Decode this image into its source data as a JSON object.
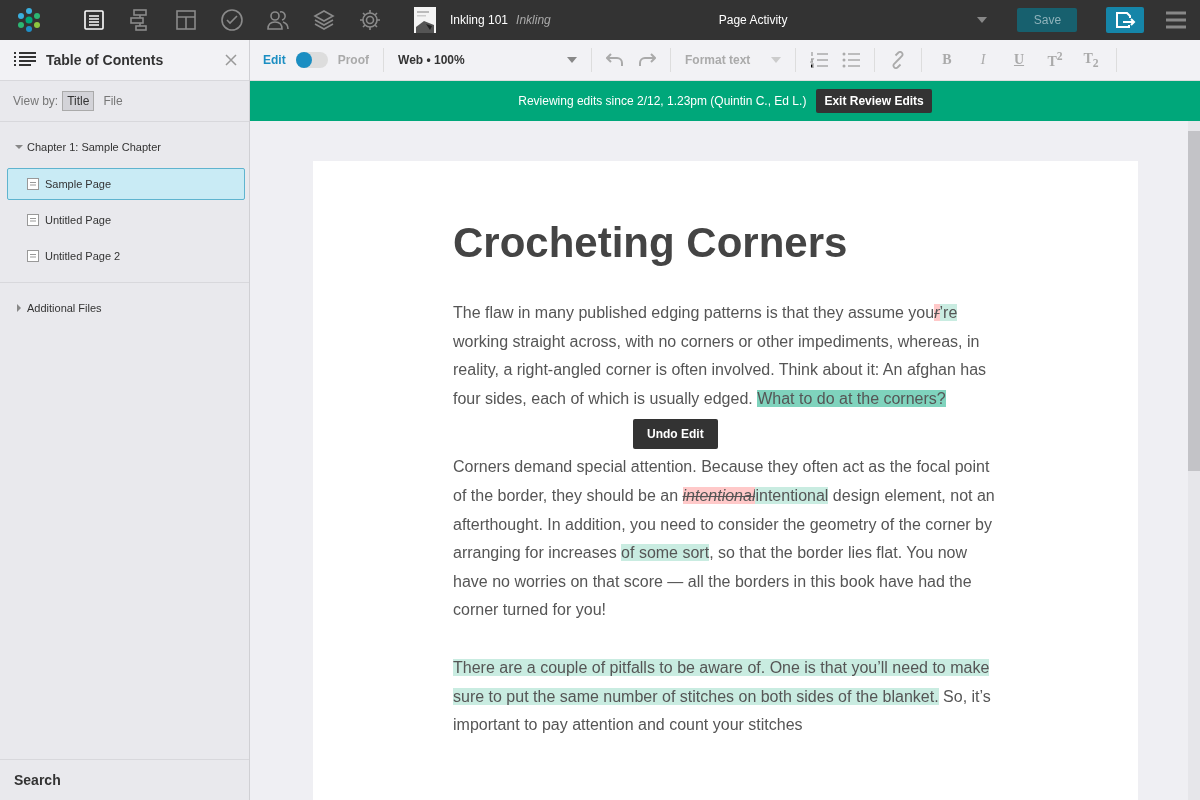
{
  "top_bar": {
    "nav": [
      {
        "kind": "document",
        "selected": true
      },
      {
        "kind": "outline",
        "selected": false
      },
      {
        "kind": "layout",
        "selected": false
      },
      {
        "kind": "check",
        "selected": false
      },
      {
        "kind": "people",
        "selected": false
      },
      {
        "kind": "layers",
        "selected": false
      },
      {
        "kind": "settings",
        "selected": false
      }
    ],
    "project": {
      "title": "Inkling 101",
      "owner": "Inkling"
    },
    "activity": {
      "label": "Page Activity"
    },
    "save": {
      "label": "Save"
    }
  },
  "sidebar": {
    "title": "Table of Contents",
    "view_by": {
      "label": "View by:",
      "options": [
        {
          "label": "Title",
          "selected": true
        },
        {
          "label": "File",
          "selected": false
        }
      ]
    },
    "tree": [
      {
        "label": "Chapter 1: Sample Chapter",
        "expanded": true,
        "children": [
          {
            "label": "Sample Page",
            "selected": true
          },
          {
            "label": "Untitled Page",
            "selected": false
          },
          {
            "label": "Untitled Page 2",
            "selected": false
          }
        ]
      },
      {
        "label": "Additional Files",
        "expanded": false
      }
    ],
    "search": "Search"
  },
  "toolbar": {
    "mode": [
      {
        "label": "Edit",
        "selected": true
      },
      {
        "label": "Proof",
        "selected": false
      }
    ],
    "view": "Web • 100%",
    "format": "Format text",
    "styles": [
      "B",
      "I",
      "U",
      "T$^{2}$",
      "T$_{2}$"
    ]
  },
  "review_banner": {
    "text": "Reviewing edits since 2/12, 1.23pm (Quintin C., Ed L.)",
    "button": "Exit Review Edits"
  },
  "document": {
    "title": "Crocheting Corners",
    "tooltip": "Undo Edit",
    "paragraphs": [
      [
        {
          "kind": "plain",
          "text": "The flaw in many published edging patterns is that they assume you"
        },
        {
          "kind": "deleted",
          "text": "r"
        },
        {
          "kind": "inserted",
          "text": "’re"
        },
        {
          "kind": "plain",
          "text": " working straight across, with no corners or other impediments, whereas, in reality, a right-angled corner is often involved. Think about it: An afghan has four sides, each of which is usually edged. "
        },
        {
          "kind": "focused",
          "text": "What to do at the corners?"
        }
      ],
      [
        {
          "kind": "plain",
          "text": "Corners demand special attention. Because they often act as the focal point of the border, they should be an "
        },
        {
          "kind": "deleted",
          "text": "intentional"
        },
        {
          "kind": "inserted",
          "text": "intentional"
        },
        {
          "kind": "plain",
          "text": " design element, not an afterthought. In addition, you need to consider the geometry of the corner by arranging for increases "
        },
        {
          "kind": "inserted",
          "text": "of some sort"
        },
        {
          "kind": "plain",
          "text": ", so that the border lies flat. You now have no worries on that score — all the borders in this book have had the corner turned for you!"
        }
      ],
      [
        {
          "kind": "inserted",
          "text": "There are a couple of pitfalls to be aware of. One is that you’ll need to make sure to put the same number of stitches on both sides of the blanket."
        },
        {
          "kind": "plain",
          "text": " So, it’s important to pay attention and count your stitches"
        }
      ]
    ]
  }
}
